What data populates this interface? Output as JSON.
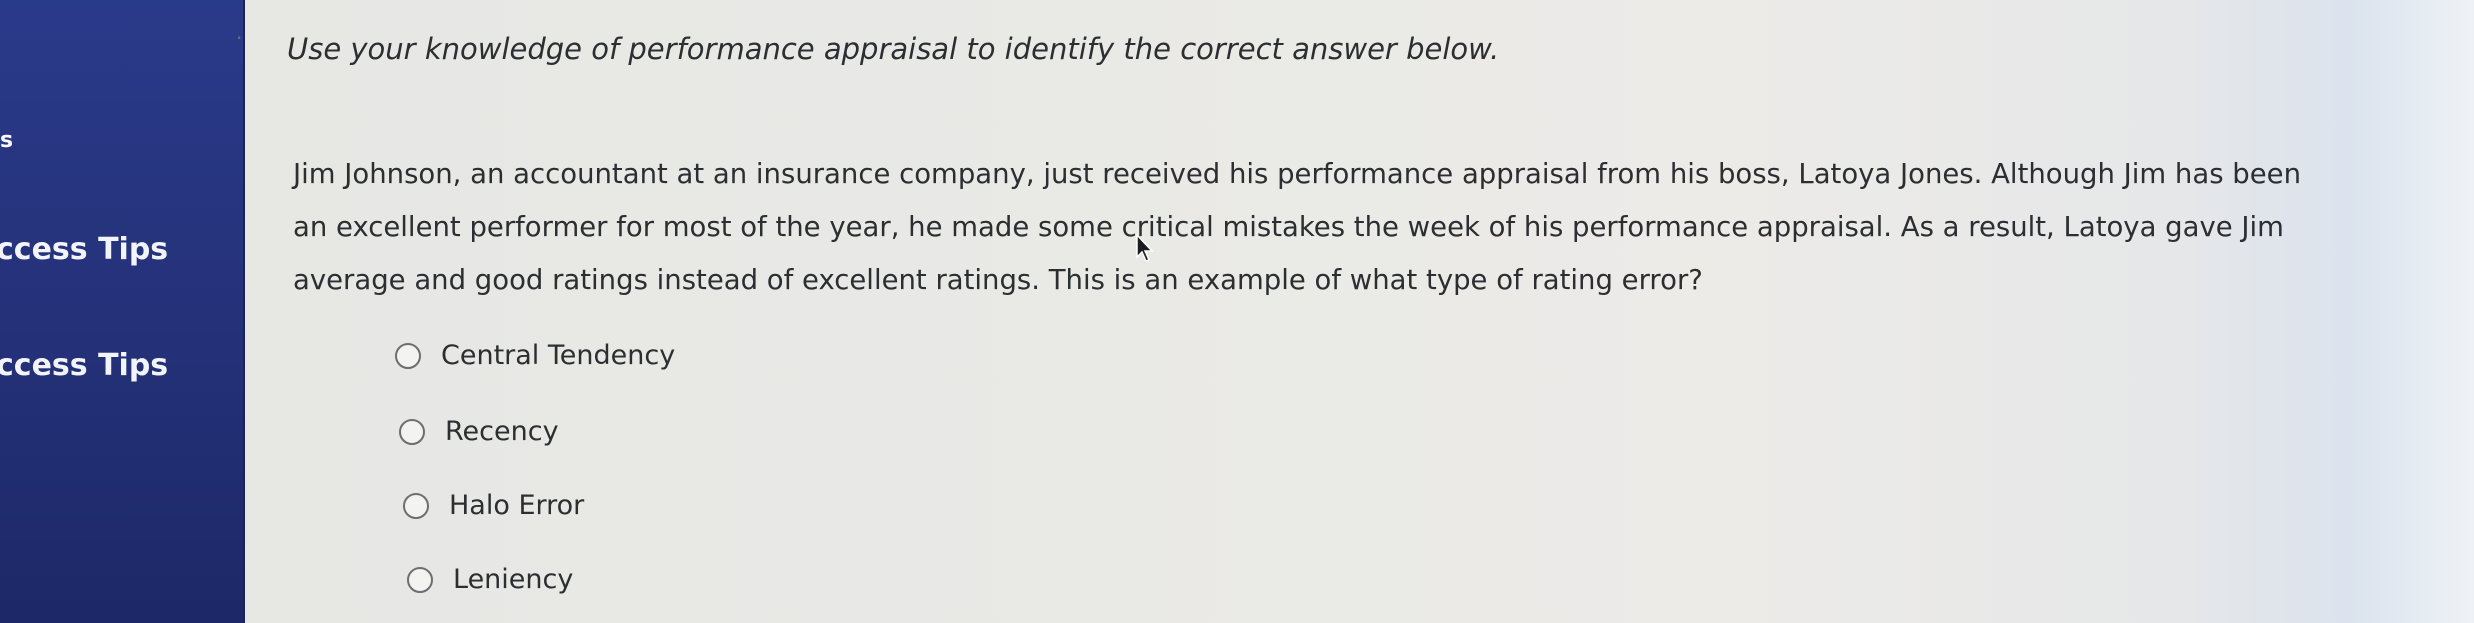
{
  "sidebar": {
    "marker": "s",
    "items": [
      {
        "label": "ccess Tips"
      },
      {
        "label": "ccess Tips"
      }
    ]
  },
  "question": {
    "bullet": "·",
    "instruction": "Use your knowledge of performance appraisal to identify the correct answer below.",
    "prompt": "Jim Johnson, an accountant at an insurance company, just received his performance appraisal from his boss, Latoya Jones. Although Jim has been an excellent performer for most of the year, he made some critical mistakes the week of his performance appraisal. As a result, Latoya gave Jim average and good ratings instead of excellent ratings. This is an example of what type of rating error?",
    "options": [
      {
        "label": "Central Tendency",
        "selected": false
      },
      {
        "label": "Recency",
        "selected": false
      },
      {
        "label": "Halo Error",
        "selected": false
      },
      {
        "label": "Leniency",
        "selected": false
      }
    ]
  },
  "colors": {
    "sidebar_bg": "#25327a",
    "page_bg": "#e9e9e6",
    "text": "#2c2e32"
  },
  "icons": [
    "radio-button-icon",
    "mouse-cursor-icon"
  ]
}
